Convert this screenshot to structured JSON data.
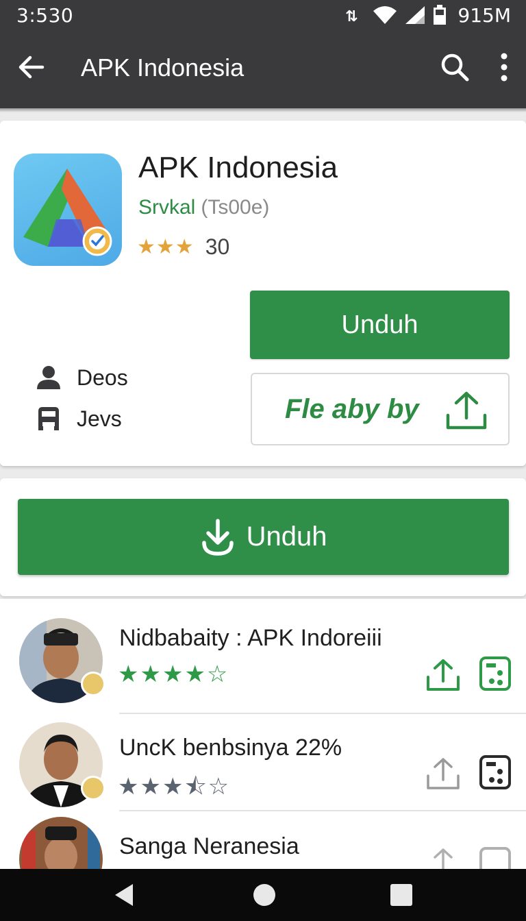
{
  "status_bar": {
    "time": "3:530",
    "right_text": "915M",
    "icons": [
      "data-sync-icon",
      "wifi-icon",
      "signal-icon",
      "battery-icon"
    ]
  },
  "app_bar": {
    "title": "APK Indonesia",
    "back_icon": "arrow-left-icon",
    "search_icon": "search-icon",
    "more_icon": "more-vert-icon"
  },
  "app": {
    "name": "APK Indonesia",
    "developer": "Srvkal",
    "developer_meta": "(Ts00e)",
    "stars": "★★★",
    "rating_value": 3,
    "rating_count": "30",
    "install_label": "Unduh",
    "share_label": "Fle aby by",
    "info": [
      {
        "icon": "person-icon",
        "label": "Deos"
      },
      {
        "icon": "vehicle-icon",
        "label": "Jevs"
      }
    ]
  },
  "download": {
    "label": "Unduh",
    "icon": "download-icon"
  },
  "reviews": [
    {
      "name": "Nidbabaity : APK Indoreiii",
      "stars": "★★★★☆",
      "rating": 4,
      "star_color": "#2e9a48"
    },
    {
      "name": "UncK benbsinya 22%",
      "stars": "★★★⯪☆",
      "rating": 3.5,
      "star_color": "#5a6470"
    },
    {
      "name": "Sanga Neranesia",
      "stars": "",
      "rating": null,
      "star_color": "#5a6470"
    }
  ],
  "colors": {
    "accent_green": "#2f8f49",
    "app_bar": "#3a3a3c",
    "star_gold": "#e2a33a"
  },
  "nav_bar": {
    "icons": [
      "nav-back-icon",
      "nav-home-icon",
      "nav-recents-icon"
    ]
  }
}
